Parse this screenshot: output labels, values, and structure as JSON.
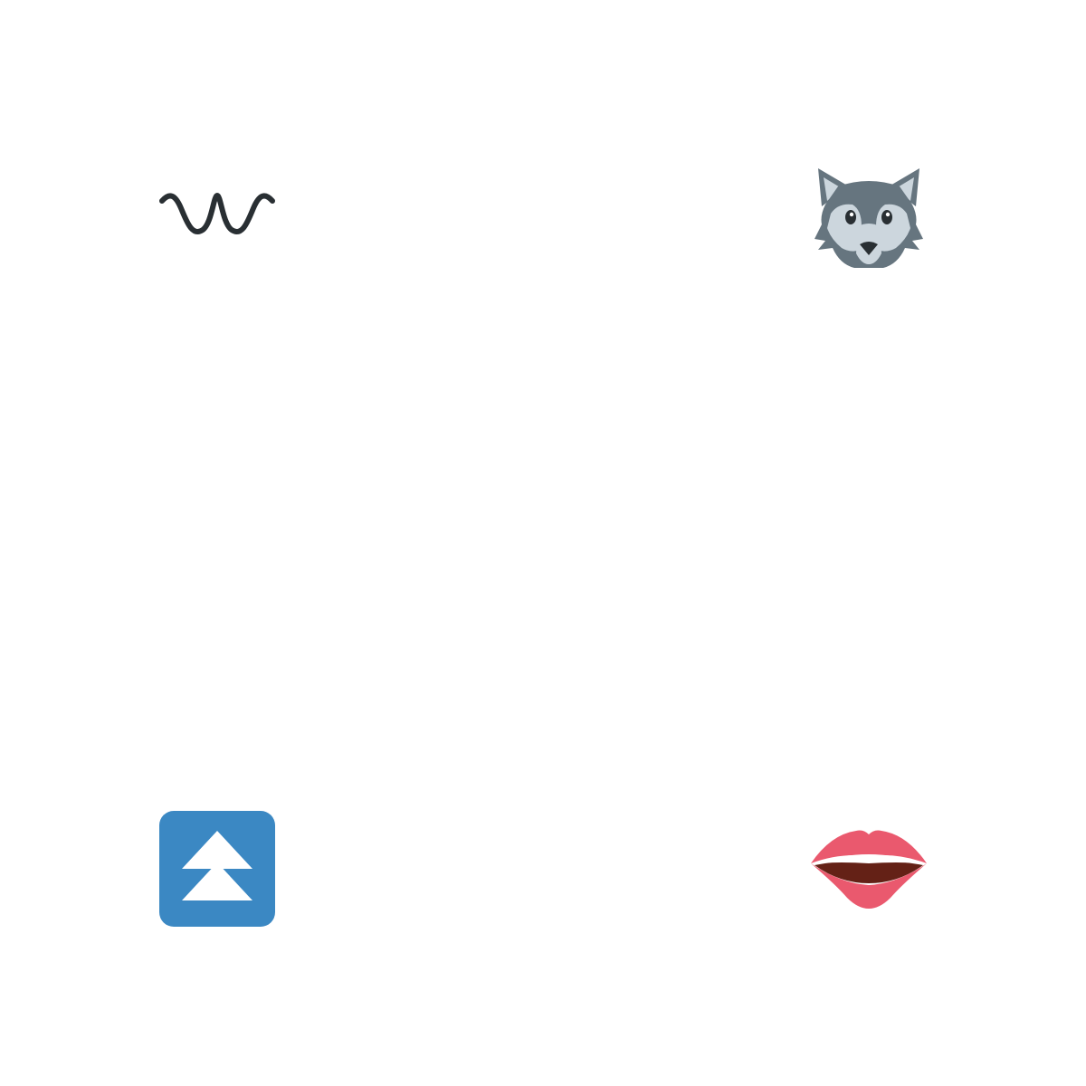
{
  "icons": [
    {
      "name": "wavy-dash-icon",
      "color": "#292f33"
    },
    {
      "name": "wolf-icon",
      "colors": {
        "dark": "#66757f",
        "light": "#ccd6dd",
        "nose": "#292f33"
      }
    },
    {
      "name": "fast-up-button-icon",
      "colors": {
        "background": "#3b88c3",
        "arrows": "#ffffff"
      }
    },
    {
      "name": "mouth-icon",
      "colors": {
        "lips": "#ea596e",
        "inside": "#642116",
        "teeth": "#ffffff"
      }
    }
  ]
}
